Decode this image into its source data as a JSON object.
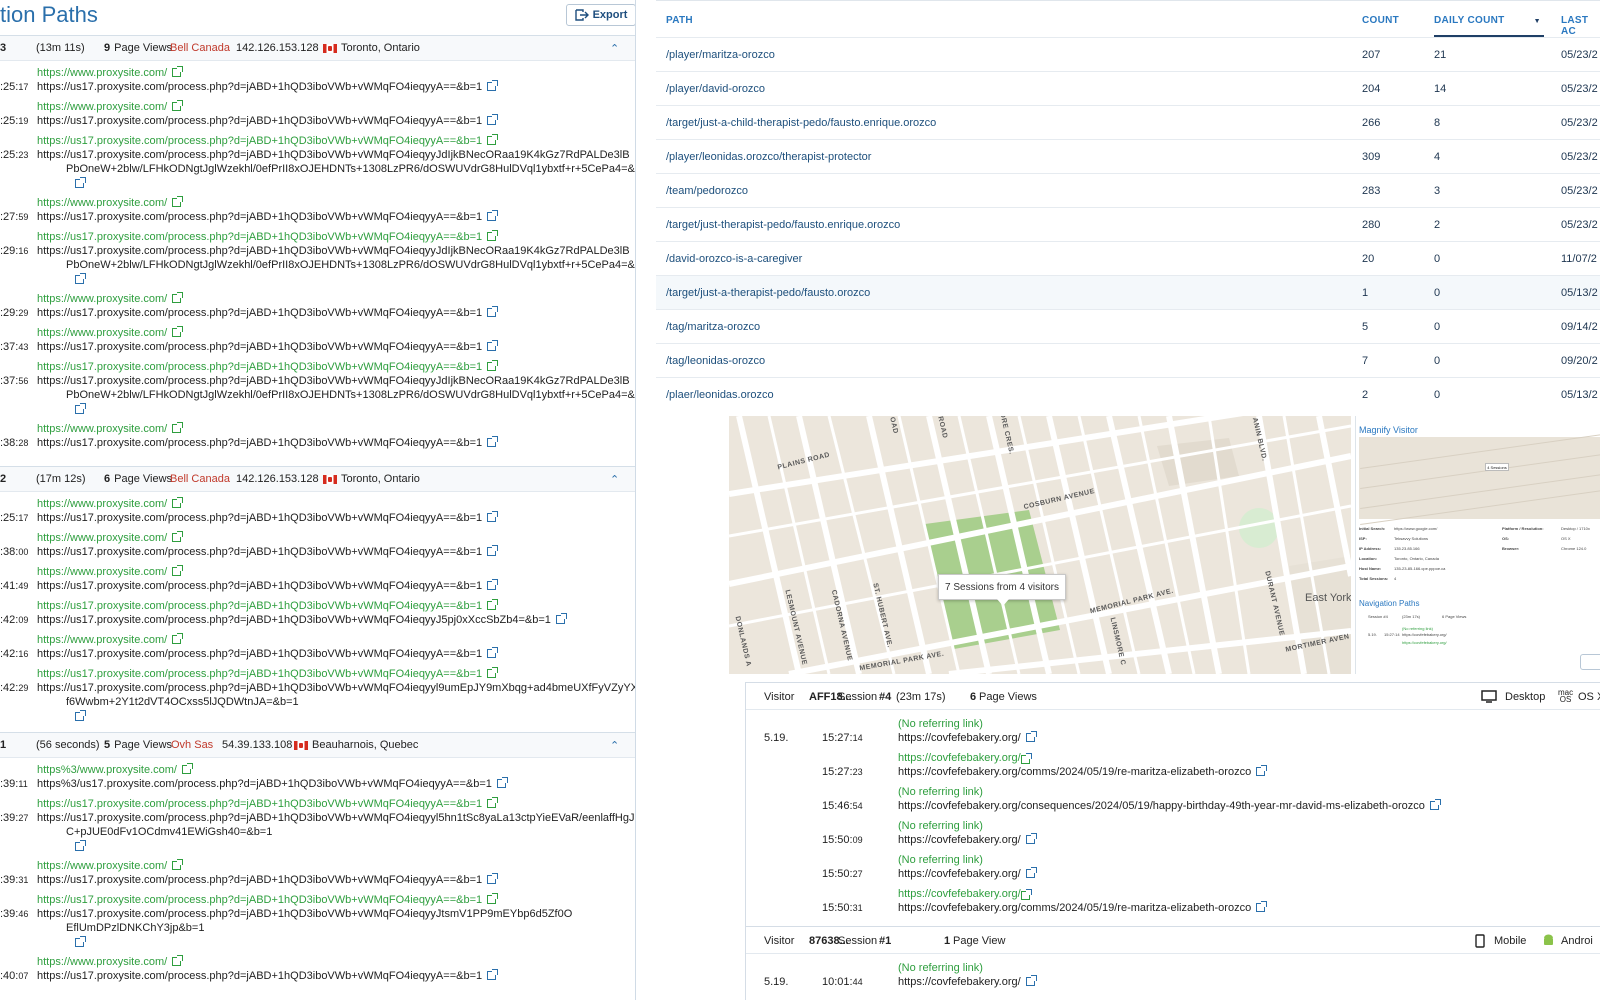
{
  "left": {
    "title": "tion Paths",
    "export_label": "Export",
    "sessions": [
      {
        "num": "3",
        "duration": "(13m 11s)",
        "page_views_count": "9",
        "page_views_label": "Page Views",
        "isp": "Bell Canada",
        "ip": "142.126.153.128",
        "location": "Toronto, Ontario",
        "entries": [
          {
            "ref": "https://www.proxysite.com/",
            "time_main": ":25:",
            "time_sec": "17",
            "url": [
              "https://us17.proxysite.com/process.php?d=jABD+1hQD3iboVWb+vWMqFO4ieqyyA==&b=1"
            ]
          },
          {
            "ref": "https://www.proxysite.com/",
            "time_main": ":25:",
            "time_sec": "19",
            "url": [
              "https://us17.proxysite.com/process.php?d=jABD+1hQD3iboVWb+vWMqFO4ieqyyA==&b=1"
            ]
          },
          {
            "ref": "https://us17.proxysite.com/process.php?d=jABD+1hQD3iboVWb+vWMqFO4ieqyyA==&b=1",
            "time_main": ":25:",
            "time_sec": "23",
            "url": [
              "https://us17.proxysite.com/process.php?d=jABD+1hQD3iboVWb+vWMqFO4ieqyyJdIjkBNecORaa19K4kGz7RdPALDe3lB",
              "PbOneW+2blw/LFHkODNgtJglWzekhl/0efPrII8xOJEHDNTs+1308LzPR6/dOSWUVdrG8HulDVql1ybxtf+r+5CePa4=&b=1"
            ]
          },
          {
            "ref": "https://www.proxysite.com/",
            "time_main": ":27:",
            "time_sec": "59",
            "url": [
              "https://us17.proxysite.com/process.php?d=jABD+1hQD3iboVWb+vWMqFO4ieqyyA==&b=1"
            ]
          },
          {
            "ref": "https://us17.proxysite.com/process.php?d=jABD+1hQD3iboVWb+vWMqFO4ieqyyA==&b=1",
            "time_main": ":29:",
            "time_sec": "16",
            "url": [
              "https://us17.proxysite.com/process.php?d=jABD+1hQD3iboVWb+vWMqFO4ieqyyJdIjkBNecORaa19K4kGz7RdPALDe3lB",
              "PbOneW+2blw/LFHkODNgtJglWzekhl/0efPrII8xOJEHDNTs+1308LzPR6/dOSWUVdrG8HulDVql1ybxtf+r+5CePa4=&b=1"
            ]
          },
          {
            "ref": "https://www.proxysite.com/",
            "time_main": ":29:",
            "time_sec": "29",
            "url": [
              "https://us17.proxysite.com/process.php?d=jABD+1hQD3iboVWb+vWMqFO4ieqyyA==&b=1"
            ]
          },
          {
            "ref": "https://www.proxysite.com/",
            "time_main": ":37:",
            "time_sec": "43",
            "url": [
              "https://us17.proxysite.com/process.php?d=jABD+1hQD3iboVWb+vWMqFO4ieqyyA==&b=1"
            ]
          },
          {
            "ref": "https://us17.proxysite.com/process.php?d=jABD+1hQD3iboVWb+vWMqFO4ieqyyA==&b=1",
            "time_main": ":37:",
            "time_sec": "56",
            "url": [
              "https://us17.proxysite.com/process.php?d=jABD+1hQD3iboVWb+vWMqFO4ieqyyJdIjkBNecORaa19K4kGz7RdPALDe3lB",
              "PbOneW+2blw/LFHkODNgtJglWzekhl/0efPrII8xOJEHDNTs+1308LzPR6/dOSWUVdrG8HulDVql1ybxtf+r+5CePa4=&b=1"
            ]
          },
          {
            "ref": "https://www.proxysite.com/",
            "time_main": ":38:",
            "time_sec": "28",
            "url": [
              "https://us17.proxysite.com/process.php?d=jABD+1hQD3iboVWb+vWMqFO4ieqyyA==&b=1"
            ]
          }
        ]
      },
      {
        "num": "2",
        "duration": "(17m 12s)",
        "page_views_count": "6",
        "page_views_label": "Page Views",
        "isp": "Bell Canada",
        "ip": "142.126.153.128",
        "location": "Toronto, Ontario",
        "entries": [
          {
            "ref": "https://www.proxysite.com/",
            "time_main": ":25:",
            "time_sec": "17",
            "url": [
              "https://us17.proxysite.com/process.php?d=jABD+1hQD3iboVWb+vWMqFO4ieqyyA==&b=1"
            ]
          },
          {
            "ref": "https://www.proxysite.com/",
            "time_main": ":38:",
            "time_sec": "00",
            "url": [
              "https://us17.proxysite.com/process.php?d=jABD+1hQD3iboVWb+vWMqFO4ieqyyA==&b=1"
            ]
          },
          {
            "ref": "https://www.proxysite.com/",
            "time_main": ":41:",
            "time_sec": "49",
            "url": [
              "https://us17.proxysite.com/process.php?d=jABD+1hQD3iboVWb+vWMqFO4ieqyyA==&b=1"
            ]
          },
          {
            "ref": "https://us17.proxysite.com/process.php?d=jABD+1hQD3iboVWb+vWMqFO4ieqyyA==&b=1",
            "time_main": ":42:",
            "time_sec": "09",
            "url": [
              "https://us17.proxysite.com/process.php?d=jABD+1hQD3iboVWb+vWMqFO4ieqyyJ5pj0xXccSbZb4=&b=1"
            ]
          },
          {
            "ref": "https://www.proxysite.com/",
            "time_main": ":42:",
            "time_sec": "16",
            "url": [
              "https://us17.proxysite.com/process.php?d=jABD+1hQD3iboVWb+vWMqFO4ieqyyA==&b=1"
            ]
          },
          {
            "ref": "https://us17.proxysite.com/process.php?d=jABD+1hQD3iboVWb+vWMqFO4ieqyyA==&b=1",
            "time_main": ":42:",
            "time_sec": "29",
            "url": [
              "https://us17.proxysite.com/process.php?d=jABD+1hQD3iboVWb+vWMqFO4ieqyyl9umEpJY9mXbqg+ad4bmeUXfFyVZyYX",
              "f6Wwbm+2Y1t2dVT4OCxss5lJQDWtnJA=&b=1"
            ]
          }
        ]
      },
      {
        "num": "1",
        "duration": "(56 seconds)",
        "page_views_count": "5",
        "page_views_label": "Page Views",
        "isp": "Ovh Sas",
        "ip": "54.39.133.108",
        "location": "Beauharnois, Quebec",
        "entries": [
          {
            "ref": "https%3/www.proxysite.com/",
            "time_main": ":39:",
            "time_sec": "11",
            "url": [
              "https%3/us17.proxysite.com/process.php?d=jABD+1hQD3iboVWb+vWMqFO4ieqyyA==&b=1"
            ]
          },
          {
            "ref": "https://us17.proxysite.com/process.php?d=jABD+1hQD3iboVWb+vWMqFO4ieqyyA==&b=1",
            "time_main": ":39:",
            "time_sec": "27",
            "url": [
              "https://us17.proxysite.com/process.php?d=jABD+1hQD3iboVWb+vWMqFO4ieqyyl5hn1tSc8yaLa13ctpYieEVaR/eenlaffHgJ",
              "C+pJUE0dFv1OCdmv41EWiGsh40=&b=1"
            ]
          },
          {
            "ref": "https://www.proxysite.com/",
            "time_main": ":39:",
            "time_sec": "31",
            "url": [
              "https://us17.proxysite.com/process.php?d=jABD+1hQD3iboVWb+vWMqFO4ieqyyA==&b=1"
            ]
          },
          {
            "ref": "https://us17.proxysite.com/process.php?d=jABD+1hQD3iboVWb+vWMqFO4ieqyyA==&b=1",
            "time_main": ":39:",
            "time_sec": "46",
            "url": [
              "https://us17.proxysite.com/process.php?d=jABD+1hQD3iboVWb+vWMqFO4ieqyyJtsmV1PP9mEYbp6d5Zf0O",
              "EflUmDPzlDNKChY3jp&b=1"
            ]
          },
          {
            "ref": "https://www.proxysite.com/",
            "time_main": ":40:",
            "time_sec": "07",
            "url": [
              "https://us17.proxysite.com/process.php?d=jABD+1hQD3iboVWb+vWMqFO4ieqyyA==&b=1"
            ]
          }
        ]
      }
    ]
  },
  "paths_table": {
    "headers": {
      "path": "PATH",
      "count": "COUNT",
      "daily_count": "DAILY COUNT",
      "last": "LAST AC"
    },
    "rows": [
      {
        "path": "/player/maritza-orozco",
        "count": "207",
        "daily": "21",
        "last": "05/23/2"
      },
      {
        "path": "/player/david-orozco",
        "count": "204",
        "daily": "14",
        "last": "05/23/2"
      },
      {
        "path": "/target/just-a-child-therapist-pedo/fausto.enrique.orozco",
        "count": "266",
        "daily": "8",
        "last": "05/23/2"
      },
      {
        "path": "/player/leonidas.orozco/therapist-protector",
        "count": "309",
        "daily": "4",
        "last": "05/23/2"
      },
      {
        "path": "/team/pedorozco",
        "count": "283",
        "daily": "3",
        "last": "05/23/2"
      },
      {
        "path": "/target/just-therapist-pedo/fausto.enrique.orozco",
        "count": "280",
        "daily": "2",
        "last": "05/23/2"
      },
      {
        "path": "/david-orozco-is-a-caregiver",
        "count": "20",
        "daily": "0",
        "last": "11/07/2"
      },
      {
        "path": "/target/just-a-therapist-pedo/fausto.orozco",
        "count": "1",
        "daily": "0",
        "last": "05/13/2"
      },
      {
        "path": "/tag/maritza-orozco",
        "count": "5",
        "daily": "0",
        "last": "09/14/2"
      },
      {
        "path": "/tag/leonidas-orozco",
        "count": "7",
        "daily": "0",
        "last": "09/20/2"
      },
      {
        "path": "/plaer/leonidas.orozco",
        "count": "2",
        "daily": "0",
        "last": "05/13/2"
      }
    ]
  },
  "map": {
    "streets": [
      "PLAINS ROAD",
      "COSBURN AVENUE",
      "MEMORIAL PARK AVE.",
      "MEMORIAL PARK AVE.",
      "MORTIMER AVEN",
      "LESMOUNT AVENUE",
      "CADORNA AVENUE",
      "ST. HUBERT AVE.",
      "LINSMORE C",
      "DURANT AVENUE",
      "DONLANDS A",
      "OAD",
      "ROAD",
      "ORE CRES.",
      "ANIN BLVD."
    ],
    "place": "East York",
    "tooltip": "7 Sessions from 4 visitors"
  },
  "magnify": {
    "title": "Magnify Visitor",
    "nav_title": "Navigation Paths",
    "badge": "4 Sessions",
    "details": [
      "Initial Search:",
      "https://www.google.com/",
      "ISP:",
      "Teksavvy Solutions",
      "IP Address:",
      "135.23.85.166",
      "Location:",
      "Toronto, Ontario, Canada",
      "Host Name:",
      "135-23-85-166.cpe.pppoe.ca",
      "Total Sessions:",
      "4",
      "Platform / Resolution:",
      "Desktop / 1710x",
      "OS:",
      "OS X",
      "Browser:",
      "Chrome 124.0"
    ],
    "nav_row": [
      "Session #4",
      "(23m 17s)",
      "6 Page Views",
      "5.19.",
      "15:27:14",
      "(No referring link)",
      "https://covfefebakery.org/",
      "https://covfefebakery.org/"
    ]
  },
  "visitor_sessions": [
    {
      "visitor_label": "Visitor",
      "visitor_id": "AFF18...",
      "session_label": "Session",
      "session_num": "#4",
      "duration": "(23m 17s)",
      "pv_count": "6",
      "pv_label": "Page Views",
      "device": "Desktop",
      "os": "OS X",
      "entries": [
        {
          "date": "5.19.",
          "time_main": "15:27:",
          "time_sec": "14",
          "ref": "(No referring link)",
          "url": "https://covfefebakery.org/"
        },
        {
          "date": "",
          "time_main": "15:27:",
          "time_sec": "23",
          "ref": "https://covfefebakery.org/",
          "url": "https://covfefebakery.org/comms/2024/05/19/re-maritza-elizabeth-orozco"
        },
        {
          "date": "",
          "time_main": "15:46:",
          "time_sec": "54",
          "ref": "(No referring link)",
          "url": "https://covfefebakery.org/consequences/2024/05/19/happy-birthday-49th-year-mr-david-ms-elizabeth-orozco"
        },
        {
          "date": "",
          "time_main": "15:50:",
          "time_sec": "09",
          "ref": "(No referring link)",
          "url": "https://covfefebakery.org/"
        },
        {
          "date": "",
          "time_main": "15:50:",
          "time_sec": "27",
          "ref": "(No referring link)",
          "url": "https://covfefebakery.org/"
        },
        {
          "date": "",
          "time_main": "15:50:",
          "time_sec": "31",
          "ref": "https://covfefebakery.org/",
          "url": "https://covfefebakery.org/comms/2024/05/19/re-maritza-elizabeth-orozco"
        }
      ]
    },
    {
      "visitor_label": "Visitor",
      "visitor_id": "87638...",
      "session_label": "Session",
      "session_num": "#1",
      "pv_count": "1",
      "pv_label": "Page View",
      "device": "Mobile",
      "os": "Androi",
      "entries": [
        {
          "date": "5.19.",
          "time_main": "10:01:",
          "time_sec": "44",
          "ref": "(No referring link)",
          "url": "https://covfefebakery.org/"
        }
      ]
    }
  ],
  "colors": {
    "accent": "#2a78c0",
    "referrer_green": "#2e9e3e",
    "isp_red": "#c0392b",
    "map_bg": "#ece6dc",
    "park_green": "#a9cf8e"
  }
}
